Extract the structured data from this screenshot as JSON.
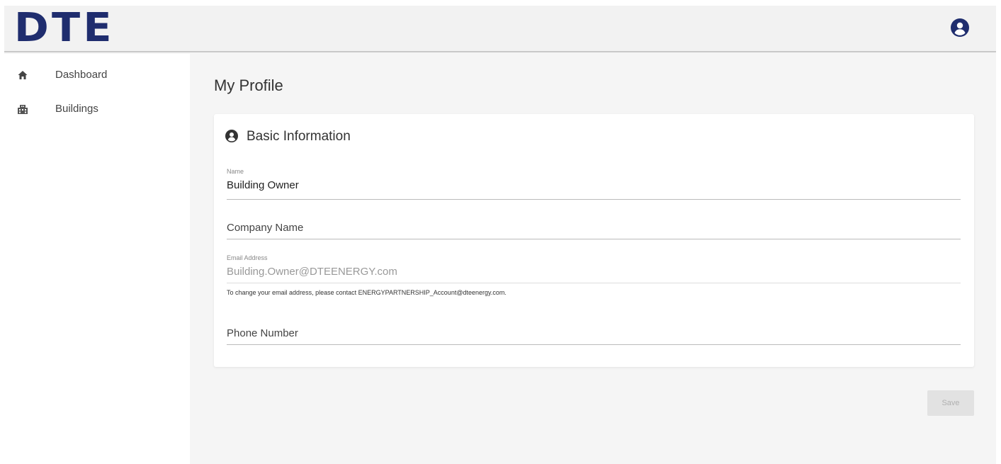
{
  "header": {
    "logo_text": "DTE",
    "account_icon": "account-circle-icon",
    "brand_color": "#1f2d6e"
  },
  "sidebar": {
    "items": [
      {
        "label": "Dashboard",
        "icon": "home-icon"
      },
      {
        "label": "Buildings",
        "icon": "buildings-icon"
      }
    ]
  },
  "main": {
    "page_title": "My Profile",
    "card": {
      "title": "Basic Information",
      "title_icon": "account-circle-icon",
      "fields": {
        "name": {
          "label": "Name",
          "value": "Building Owner"
        },
        "company": {
          "placeholder": "Company Name",
          "value": ""
        },
        "email": {
          "label": "Email Address",
          "value": "Building.Owner@DTEENERGY.com",
          "disabled": true
        },
        "email_helper": "To change your email address, please contact ENERGYPARTNERSHIP_Account@dteenergy.com.",
        "phone": {
          "placeholder": "Phone Number",
          "value": ""
        }
      }
    },
    "save_label": "Save"
  }
}
